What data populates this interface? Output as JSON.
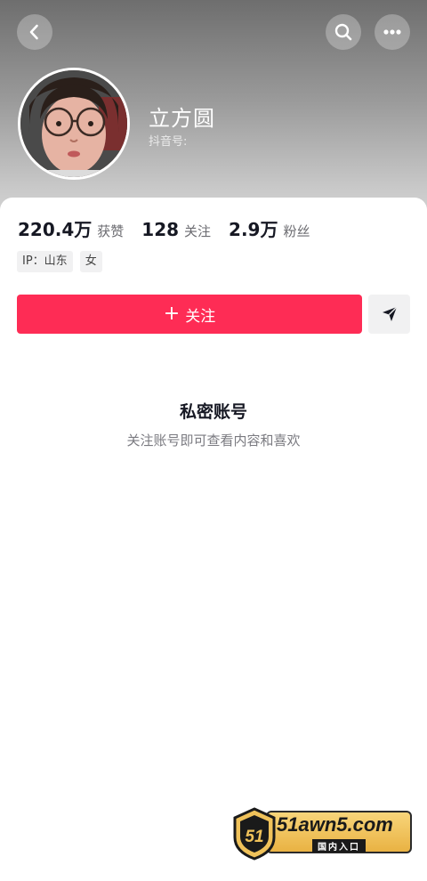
{
  "profile": {
    "name": "立方圆",
    "douyin_id_label": "抖音号:"
  },
  "stats": [
    {
      "value": "220.4万",
      "label": "获赞"
    },
    {
      "value": "128",
      "label": "关注"
    },
    {
      "value": "2.9万",
      "label": "粉丝"
    }
  ],
  "tags": {
    "ip": "IP：山东",
    "gender": "女"
  },
  "actions": {
    "follow_plus": "+",
    "follow_label": "关注"
  },
  "private": {
    "title": "私密账号",
    "description": "关注账号即可查看内容和喜欢"
  },
  "watermark": {
    "badge": "51",
    "domain": "51awn5.com",
    "subtitle": "国内入口"
  },
  "colors": {
    "accent": "#fe2c55",
    "watermark_gold": "#e9b243"
  },
  "icons": {
    "back": "chevron-left-icon",
    "search": "search-icon",
    "more": "more-icon",
    "send": "send-icon"
  }
}
